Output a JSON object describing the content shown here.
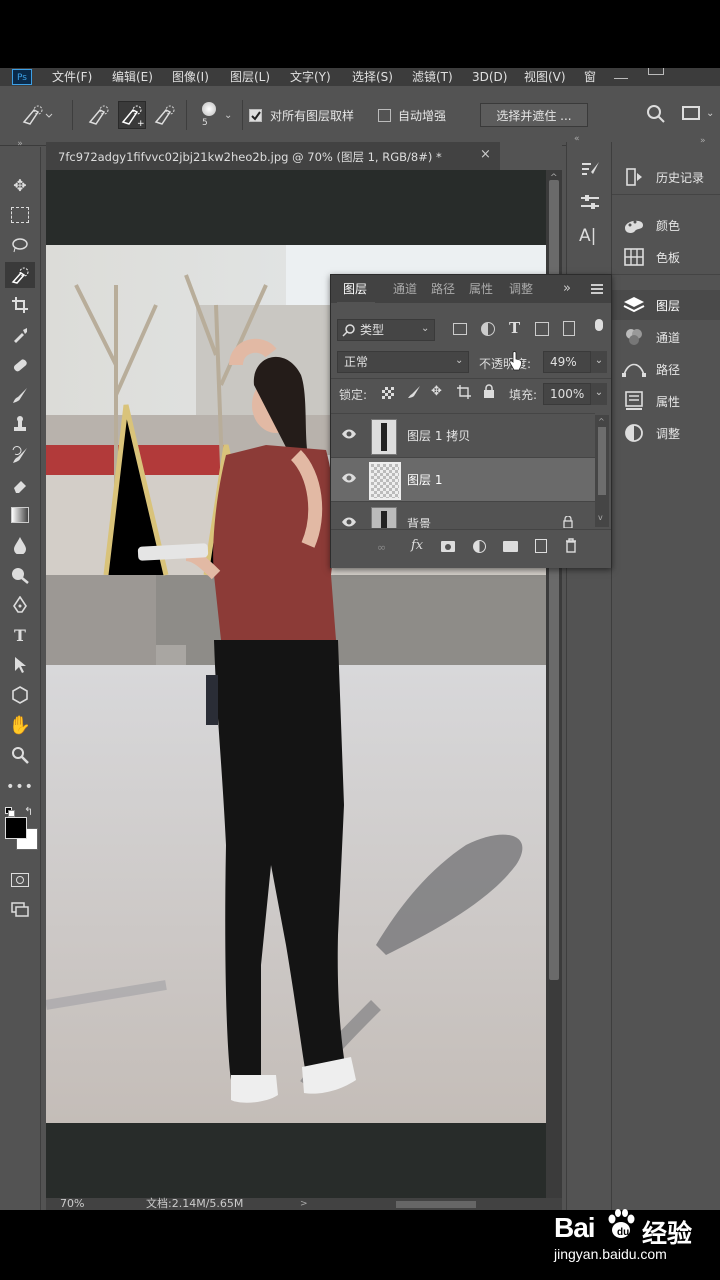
{
  "menubar": {
    "logo": "Ps",
    "items": [
      "文件(F)",
      "编辑(E)",
      "图像(I)",
      "图层(L)",
      "文字(Y)",
      "选择(S)",
      "滤镜(T)",
      "3D(D)",
      "视图(V)",
      "窗"
    ]
  },
  "options": {
    "brush_size": "5",
    "sample_all_layers_label": "对所有图层取样",
    "sample_all_layers_checked": true,
    "auto_enhance_label": "自动增强",
    "auto_enhance_checked": false,
    "select_mask_button": "选择并遮住 ..."
  },
  "document": {
    "tab_title": "7fc972adgy1fifvvc02jbj21kw2heo2b.jpg @ 70% (图层 1, RGB/8#) *",
    "close": "×",
    "zoom": "70%",
    "doc_info": "文档:2.14M/5.65M"
  },
  "right_panel": {
    "items": [
      {
        "label": "历史记录",
        "icon": "history-icon"
      },
      {
        "label": "颜色",
        "icon": "color-icon"
      },
      {
        "label": "色板",
        "icon": "swatches-icon"
      },
      {
        "label": "图层",
        "icon": "layers-icon"
      },
      {
        "label": "通道",
        "icon": "channels-icon"
      },
      {
        "label": "路径",
        "icon": "paths-icon"
      },
      {
        "label": "属性",
        "icon": "properties-icon"
      },
      {
        "label": "调整",
        "icon": "adjustments-icon"
      }
    ]
  },
  "layers_panel": {
    "tabs": [
      "图层",
      "通道",
      "路径",
      "属性",
      "调整"
    ],
    "filter_kind": "类型",
    "blend_mode": "正常",
    "opacity_label": "不透明度:",
    "opacity_value": "49%",
    "lock_label": "锁定:",
    "fill_label": "填充:",
    "fill_value": "100%",
    "layers": [
      {
        "name": "图层 1 拷贝",
        "selected": false
      },
      {
        "name": "图层 1",
        "selected": true
      },
      {
        "name": "背景",
        "selected": false
      }
    ],
    "footer_fx": "fx"
  },
  "watermark": {
    "brand": "Bai",
    "brand_cn": "经验",
    "url": "jingyan.baidu.com"
  }
}
